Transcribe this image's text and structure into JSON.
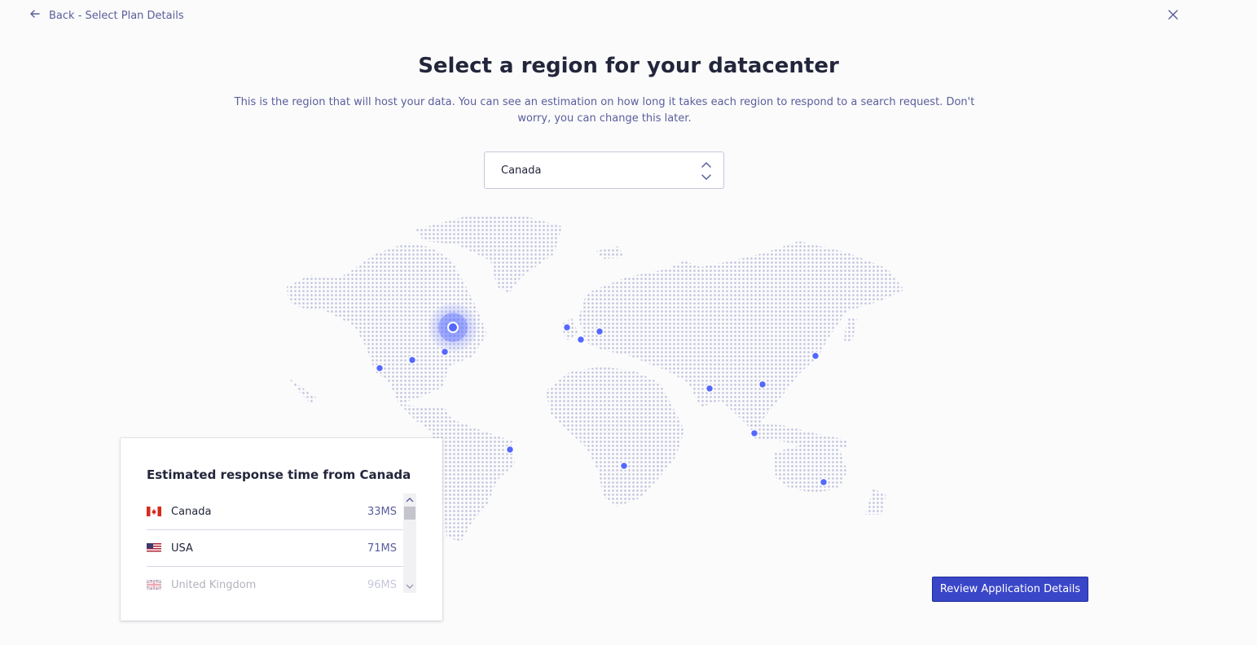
{
  "nav": {
    "back_label": "Back - Select Plan Details",
    "back_icon": "arrow-left-icon",
    "close_icon": "close-icon"
  },
  "header": {
    "title": "Select a region for your datacenter",
    "subtitle": "This is the region that will host your data. You can see an estimation on how long it takes each region to respond to a search request. Don't worry, you can change this later."
  },
  "region_select": {
    "selected": "Canada",
    "icon": "chevron-up-down-icon"
  },
  "latency_card": {
    "title": "Estimated response time from Canada",
    "rows": [
      {
        "country": "Canada",
        "time": "33MS",
        "flag": "canada-flag-icon"
      },
      {
        "country": "USA",
        "time": "71MS",
        "flag": "usa-flag-icon"
      },
      {
        "country": "United Kingdom",
        "time": "96MS",
        "flag": "uk-flag-icon"
      }
    ]
  },
  "actions": {
    "review_label": "Review Application Details"
  },
  "colors": {
    "accent": "#3a46c8",
    "marker": "#5468ff",
    "map_dots": "#c3c6de",
    "text_secondary": "#5a5e9a"
  }
}
